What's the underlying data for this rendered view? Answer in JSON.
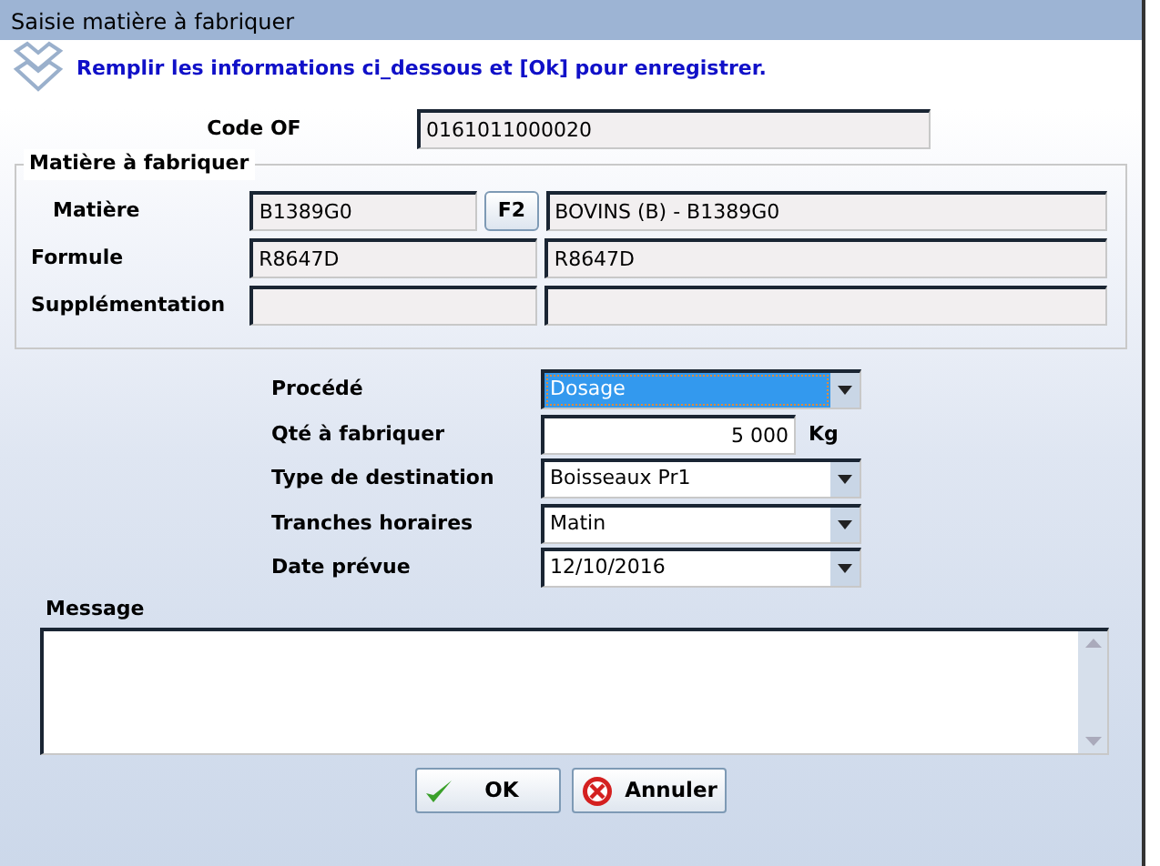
{
  "window": {
    "title": "Saisie matière à fabriquer"
  },
  "instruction": "Remplir les informations ci_dessous et [Ok] pour enregistrer.",
  "code_of": {
    "label": "Code OF",
    "value": "0161011000020"
  },
  "matiere_group": {
    "title": "Matière à fabriquer",
    "rows": [
      {
        "label": "Matière",
        "value": "B1389G0",
        "button": "F2",
        "description": "BOVINS (B) - B1389G0"
      },
      {
        "label": "Formule",
        "value": "R8647D",
        "description": "R8647D"
      },
      {
        "label": "Supplémentation"
      }
    ]
  },
  "fields": [
    {
      "kind": "combo",
      "label": "Procédé",
      "value": "Dosage",
      "selected": true
    },
    {
      "kind": "number",
      "label": "Qté à fabriquer",
      "value": "5 000",
      "unit": "Kg",
      "selected": false
    },
    {
      "kind": "combo",
      "label": "Type de destination",
      "value": "Boisseaux Pr1",
      "selected": false
    },
    {
      "kind": "combo",
      "label": "Tranches horaires",
      "value": "Matin",
      "selected": false
    },
    {
      "kind": "combo",
      "label": "Date prévue",
      "value": "12/10/2016",
      "selected": false
    }
  ],
  "message": {
    "label": "Message"
  },
  "buttons": [
    {
      "kind": "ok",
      "label": "OK"
    },
    {
      "kind": "cancel",
      "label": "Annuler"
    }
  ]
}
